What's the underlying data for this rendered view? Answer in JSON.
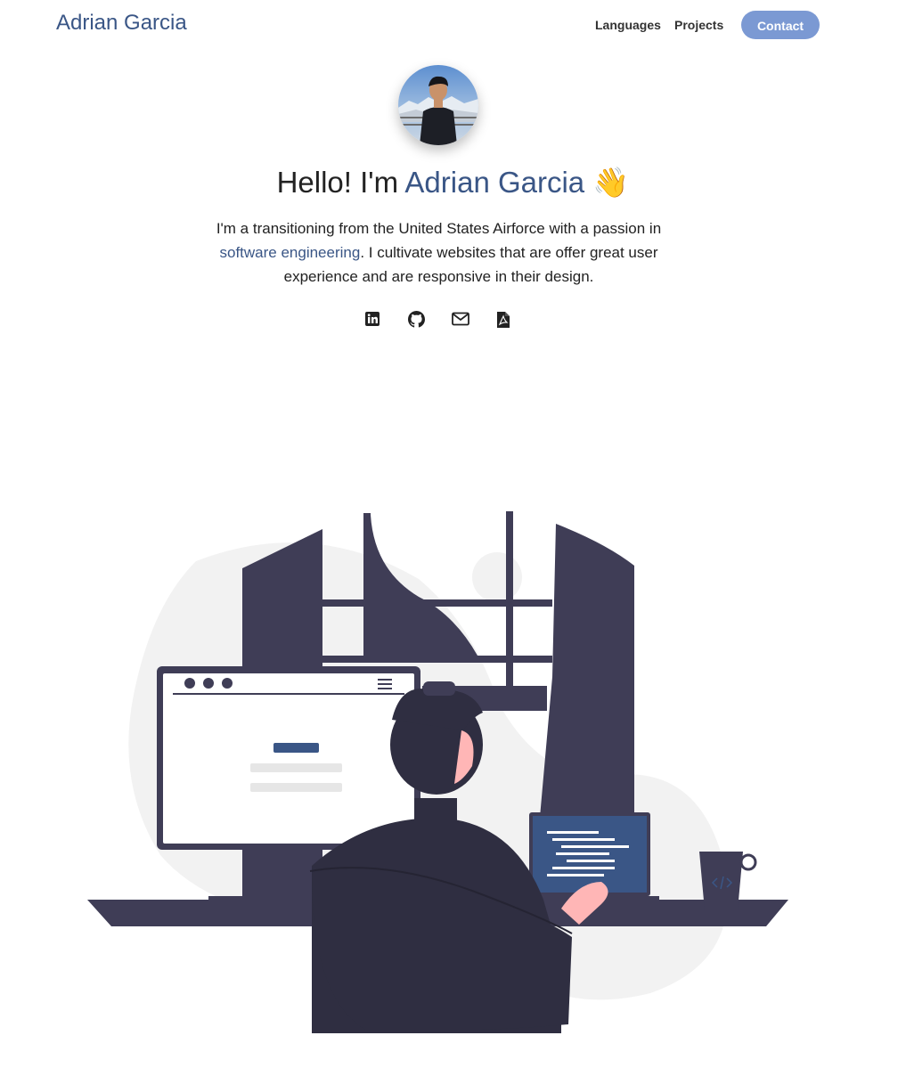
{
  "nav": {
    "brand": "Adrian Garcia",
    "links": [
      {
        "label": "Languages"
      },
      {
        "label": "Projects"
      }
    ],
    "contact_label": "Contact"
  },
  "hero": {
    "greeting": "Hello! I'm ",
    "name": "Adrian Garcia",
    "emoji": "👋",
    "bio_before": "I'm a transitioning from the United States Airforce with a passion in ",
    "bio_highlight": "software engineering",
    "bio_after": ". I cultivate websites that are offer great user experience and are responsive in their design."
  },
  "socials": [
    {
      "icon": "linkedin-icon"
    },
    {
      "icon": "github-icon"
    },
    {
      "icon": "mail-icon"
    },
    {
      "icon": "pdf-icon"
    }
  ],
  "colors": {
    "accent": "#3a5686",
    "button": "#7b99d3",
    "illustration_dark": "#3f3d56",
    "blob": "#f2f2f2"
  }
}
